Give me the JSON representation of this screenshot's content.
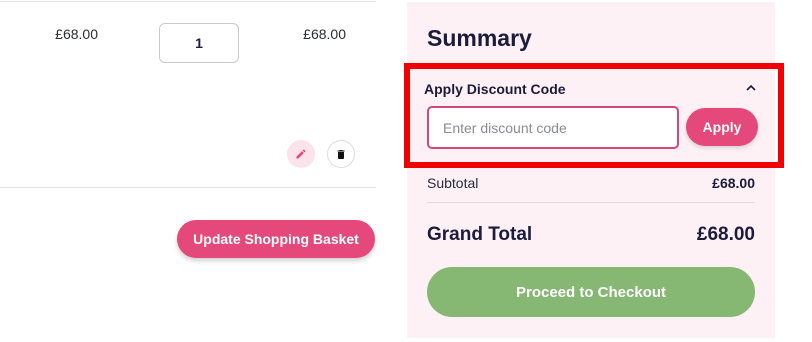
{
  "cart_item": {
    "price": "£68.00",
    "quantity": "1",
    "line_subtotal": "£68.00",
    "edit_icon": "pencil-icon",
    "delete_icon": "trash-icon"
  },
  "cart_actions": {
    "update_label": "Update Shopping Basket"
  },
  "summary": {
    "title": "Summary",
    "discount": {
      "label": "Apply Discount Code",
      "toggle_icon": "chevron-up-icon",
      "placeholder": "Enter discount code",
      "value": "",
      "apply_label": "Apply"
    },
    "subtotal_label": "Subtotal",
    "subtotal_value": "£68.00",
    "grand_total_label": "Grand Total",
    "grand_total_value": "£68.00",
    "checkout_label": "Proceed to Checkout"
  },
  "colors": {
    "accent_pink": "#e5487a",
    "checkout_green": "#86b874",
    "summary_bg": "#fdf1f6",
    "highlight_red": "#f00000"
  }
}
